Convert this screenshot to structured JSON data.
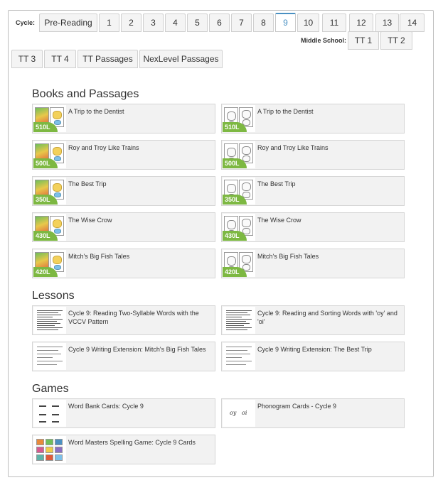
{
  "cycle_label": "Cycle:",
  "middle_school_label": "Middle School:",
  "cycle_tabs": [
    "Pre-Reading",
    "1",
    "2",
    "3",
    "4",
    "5",
    "6",
    "7",
    "8",
    "9",
    "10",
    "11",
    "12",
    "13",
    "14"
  ],
  "active_cycle": "9",
  "ms_tabs": [
    "TT 1",
    "TT 2"
  ],
  "row2_tabs": [
    "TT 3",
    "TT 4",
    "TT Passages",
    "NexLevel Passages"
  ],
  "sections": {
    "books": {
      "title": "Books and Passages",
      "items": [
        {
          "title": "A Trip to the Dentist",
          "lexile": "510L",
          "thumb": "color-cover"
        },
        {
          "title": "A Trip to the Dentist",
          "lexile": "510L",
          "thumb": "bw-cover"
        },
        {
          "title": "Roy and Troy Like Trains",
          "lexile": "500L",
          "thumb": "color-cover"
        },
        {
          "title": "Roy and Troy Like Trains",
          "lexile": "500L",
          "thumb": "bw-cover"
        },
        {
          "title": "The Best Trip",
          "lexile": "350L",
          "thumb": "color-cover"
        },
        {
          "title": "The Best Trip",
          "lexile": "350L",
          "thumb": "bw-cover"
        },
        {
          "title": "The Wise Crow",
          "lexile": "430L",
          "thumb": "color-cover"
        },
        {
          "title": "The Wise Crow",
          "lexile": "430L",
          "thumb": "bw-cover"
        },
        {
          "title": "Mitch's Big Fish Tales",
          "lexile": "420L",
          "thumb": "color-cover"
        },
        {
          "title": "Mitch's Big Fish Tales",
          "lexile": "420L",
          "thumb": "bw-cover"
        }
      ]
    },
    "lessons": {
      "title": "Lessons",
      "items": [
        {
          "title": "Cycle 9: Reading Two-Syllable Words with the VCCV Pattern",
          "lexile": "",
          "thumb": "doc"
        },
        {
          "title": "Cycle 9: Reading and Sorting Words with 'oy' and 'oi'",
          "lexile": "",
          "thumb": "doc"
        },
        {
          "title": "Cycle 9 Writing Extension: Mitch's Big Fish Tales",
          "lexile": "",
          "thumb": "doc-light"
        },
        {
          "title": "Cycle 9 Writing Extension: The Best Trip",
          "lexile": "",
          "thumb": "doc-light"
        }
      ]
    },
    "games": {
      "title": "Games",
      "items": [
        {
          "title": "Word Bank Cards: Cycle 9",
          "lexile": "",
          "thumb": "cards"
        },
        {
          "title": "Phonogram Cards - Cycle 9",
          "lexile": "",
          "thumb": "phonogram"
        },
        {
          "title": "Word Masters Spelling Game: Cycle 9 Cards",
          "lexile": "",
          "thumb": "grid"
        }
      ]
    }
  },
  "phonogram_glyphs": [
    "oy",
    "oi"
  ],
  "colors": {
    "accent": "#4a90c2",
    "lexile_badge": "#7db842",
    "card_bg": "#f2f2f2"
  }
}
